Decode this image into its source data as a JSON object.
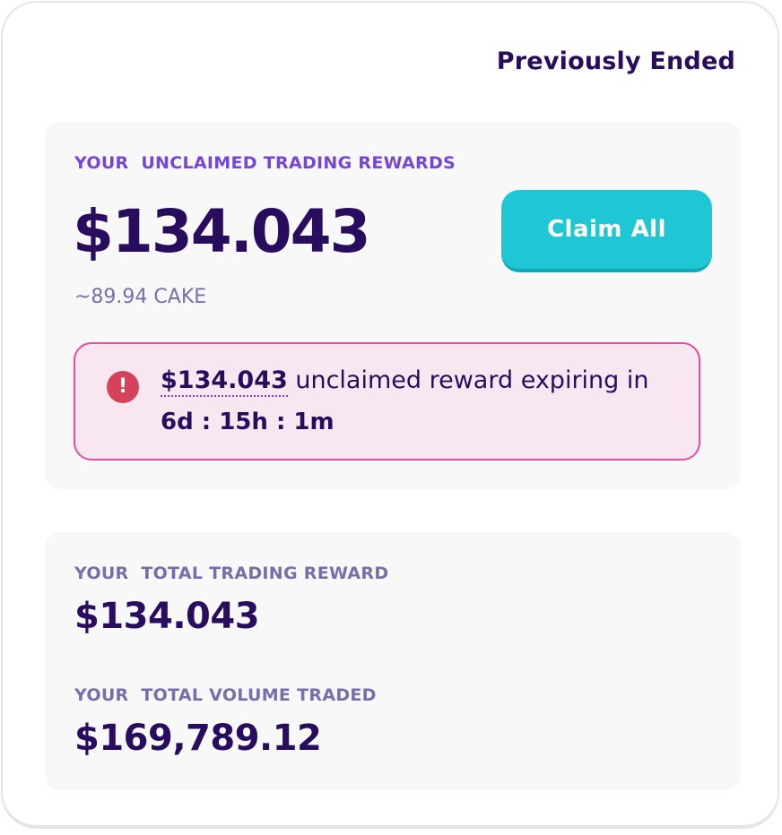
{
  "header": {
    "title": "Previously Ended"
  },
  "unclaimed": {
    "label": "YOUR  UNCLAIMED TRADING REWARDS",
    "amount": "$134.043",
    "cake_equivalent": "~89.94 CAKE",
    "claim_button_label": "Claim All",
    "alert": {
      "icon": "exclamation-icon",
      "icon_glyph": "!",
      "amount": "$134.043",
      "message": " unclaimed reward expiring in",
      "countdown": "6d : 15h : 1m"
    }
  },
  "totals": {
    "reward_label": "YOUR  TOTAL TRADING REWARD",
    "reward_amount": "$134.043",
    "volume_label": "YOUR  TOTAL VOLUME TRADED",
    "volume_amount": "$169,789.12"
  },
  "colors": {
    "primary_text": "#280d5f",
    "accent_purple": "#7645d9",
    "muted_text": "#7a6eaa",
    "button": "#1fc7d4",
    "alert_border": "#ed4b9e",
    "alert_background": "#f8e7f1",
    "alert_icon": "#d4435a"
  }
}
